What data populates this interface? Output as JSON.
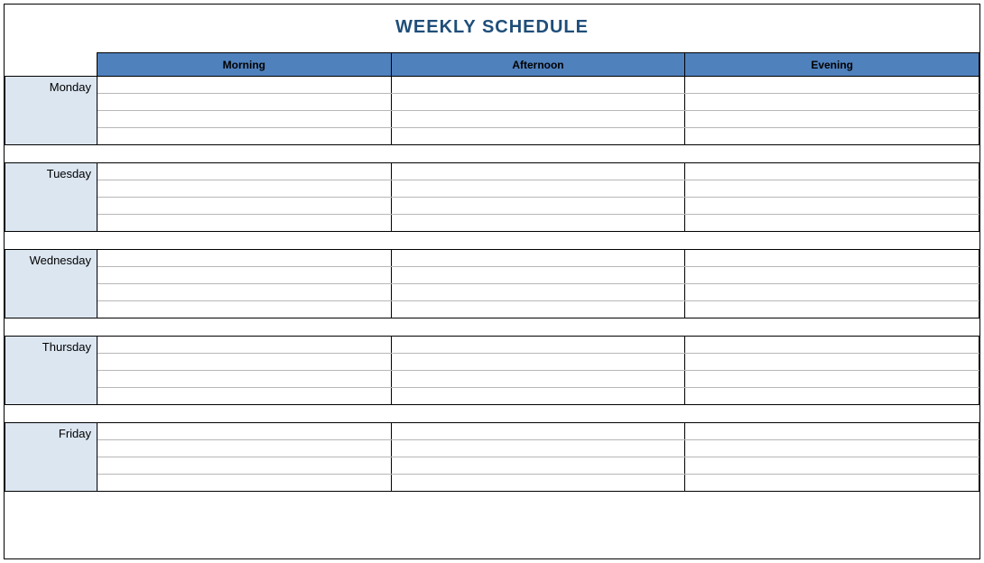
{
  "title": "WEEKLY SCHEDULE",
  "colors": {
    "title": "#1f4e79",
    "headerBg": "#4f81bd",
    "dayBg": "#dce6f1"
  },
  "columns": [
    "Morning",
    "Afternoon",
    "Evening"
  ],
  "days": [
    "Monday",
    "Tuesday",
    "Wednesday",
    "Thursday",
    "Friday"
  ],
  "schedule": {
    "Monday": {
      "Morning": [
        "",
        "",
        "",
        ""
      ],
      "Afternoon": [
        "",
        "",
        "",
        ""
      ],
      "Evening": [
        "",
        "",
        "",
        ""
      ]
    },
    "Tuesday": {
      "Morning": [
        "",
        "",
        "",
        ""
      ],
      "Afternoon": [
        "",
        "",
        "",
        ""
      ],
      "Evening": [
        "",
        "",
        "",
        ""
      ]
    },
    "Wednesday": {
      "Morning": [
        "",
        "",
        "",
        ""
      ],
      "Afternoon": [
        "",
        "",
        "",
        ""
      ],
      "Evening": [
        "",
        "",
        "",
        ""
      ]
    },
    "Thursday": {
      "Morning": [
        "",
        "",
        "",
        ""
      ],
      "Afternoon": [
        "",
        "",
        "",
        ""
      ],
      "Evening": [
        "",
        "",
        "",
        ""
      ]
    },
    "Friday": {
      "Morning": [
        "",
        "",
        "",
        ""
      ],
      "Afternoon": [
        "",
        "",
        "",
        ""
      ],
      "Evening": [
        "",
        "",
        "",
        ""
      ]
    }
  }
}
